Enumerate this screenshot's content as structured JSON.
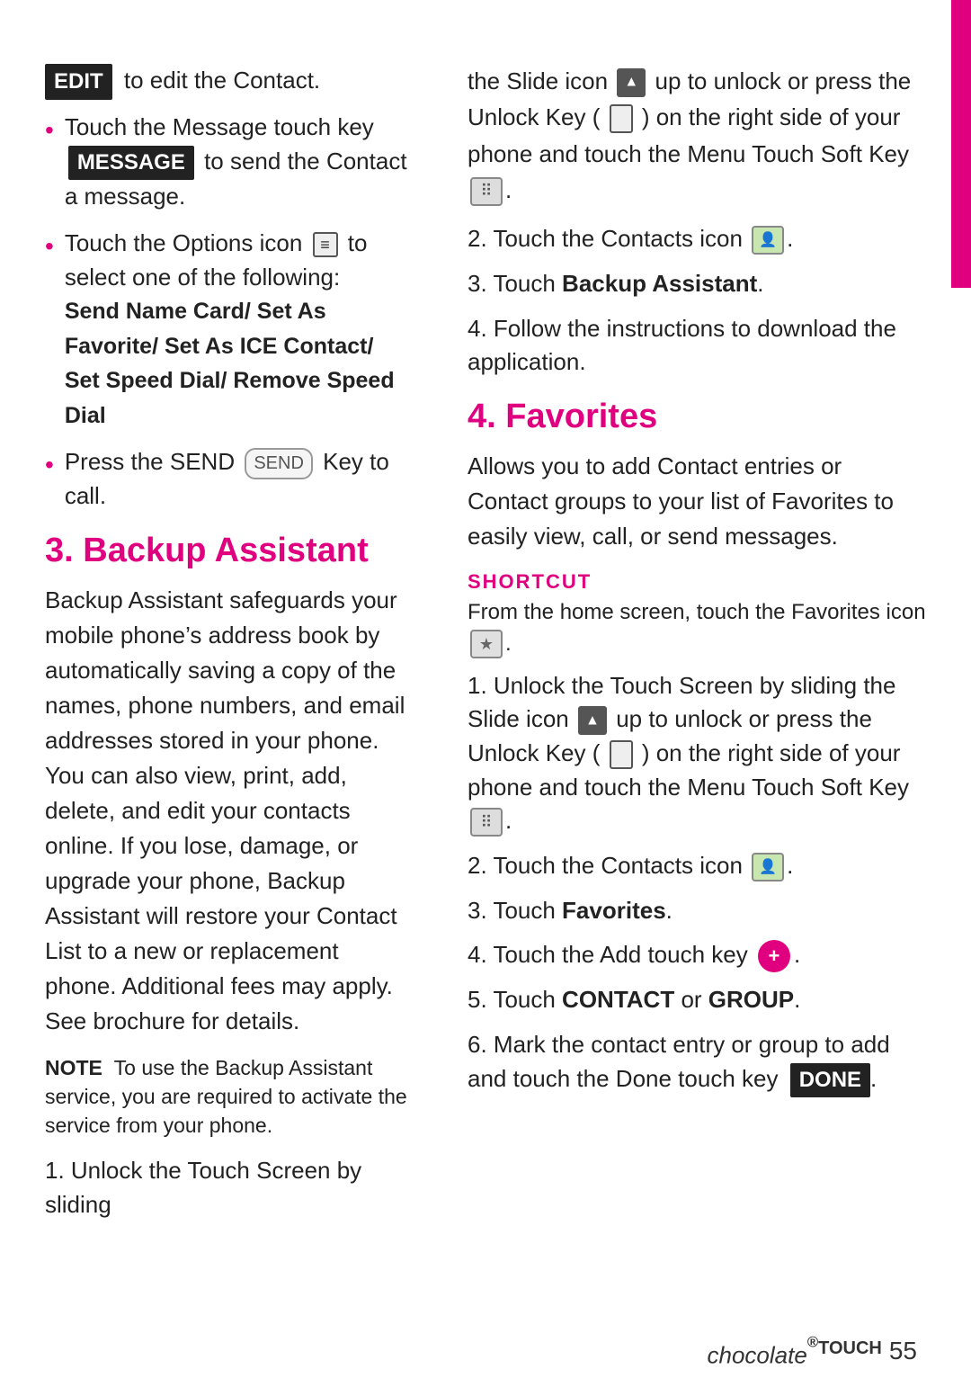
{
  "rightBorderVisible": true,
  "leftCol": {
    "editBadge": "EDIT",
    "editSuffix": " to edit the Contact.",
    "bullets": [
      {
        "id": "message-bullet",
        "text_before": "Touch the Message touch key ",
        "badge": "MESSAGE",
        "text_after": " to send the Contact a message."
      },
      {
        "id": "options-bullet",
        "text_before": "Touch the Options icon ",
        "text_after": " to select one of the following:",
        "bold_list": "Send Name Card/ Set As Favorite/ Set As ICE Contact/ Set Speed Dial/ Remove Speed Dial"
      },
      {
        "id": "send-bullet",
        "text_before": "Press the SEND ",
        "send_badge": "SEND",
        "text_after": " Key to call."
      }
    ],
    "section3_heading": "3. Backup Assistant",
    "section3_body": "Backup Assistant safeguards your mobile phone’s address book by automatically saving a copy of the names, phone numbers, and email addresses stored in your phone. You can also view, print, add, delete, and edit your contacts online. If you lose, damage, or upgrade your phone, Backup Assistant will restore your Contact List to a new or replacement phone. Additional fees may apply. See brochure for details.",
    "note_label": "NOTE",
    "note_text": "To use the Backup Assistant service, you are required to activate the service from your phone.",
    "step1_left": "1. Unlock the Touch Screen by sliding"
  },
  "rightCol": {
    "step1_continuation": "the Slide icon",
    "step1_part2": "up to unlock or press the Unlock Key (",
    "step1_part3": ") on the right side of your phone and touch the Menu Touch Soft Key",
    "step2": "2. Touch the Contacts icon",
    "step3": "3. Touch ",
    "step3_bold": "Backup Assistant",
    "step3_end": ".",
    "step4": "4. Follow the instructions to download the application.",
    "section4_heading": "4. Favorites",
    "section4_body": "Allows you to add Contact entries or Contact groups to your list of Favorites to easily view, call, or send messages.",
    "shortcut_heading": "SHORTCUT",
    "shortcut_text": "From the home screen, touch the Favorites icon",
    "fav_step1": "1. Unlock the Touch Screen by sliding the Slide icon",
    "fav_step1b": "up to unlock or press the Unlock Key (",
    "fav_step1c": ") on the right side of your phone and touch the Menu Touch Soft Key",
    "fav_step2": "2. Touch the Contacts icon",
    "fav_step3": "3. Touch ",
    "fav_step3_bold": "Favorites",
    "fav_step3_end": ".",
    "fav_step4": "4. Touch the Add touch key",
    "fav_step5_before": "5. Touch ",
    "fav_step5_bold1": "CONTACT",
    "fav_step5_mid": " or ",
    "fav_step5_bold2": "GROUP",
    "fav_step5_end": ".",
    "fav_step6_before": "6. Mark the contact entry or group to add and touch the Done touch key ",
    "fav_step6_badge": "DONE",
    "fav_step6_end": "."
  },
  "footer": {
    "brand": "chocolate",
    "touch": "TOUCH",
    "page": "55"
  }
}
